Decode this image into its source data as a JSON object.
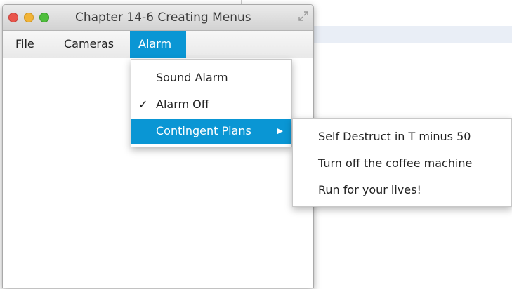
{
  "window": {
    "title": "Chapter 14-6 Creating Menus"
  },
  "menubar": {
    "items": [
      "File",
      "Cameras",
      "Alarm"
    ]
  },
  "alarm_menu": {
    "items": [
      {
        "label": "Sound Alarm",
        "check": ""
      },
      {
        "label": "Alarm Off",
        "check": "✓"
      },
      {
        "label": "Contingent Plans",
        "check": "",
        "arrow": "▶"
      }
    ]
  },
  "contingent_submenu": {
    "items": [
      "Self Destruct in T minus 50",
      "Turn off the coffee machine",
      "Run for your lives!"
    ]
  },
  "colors": {
    "accent": "#0a96d4",
    "close": "#e9554b",
    "minimize": "#f2b437",
    "zoom": "#4fbe3c"
  }
}
